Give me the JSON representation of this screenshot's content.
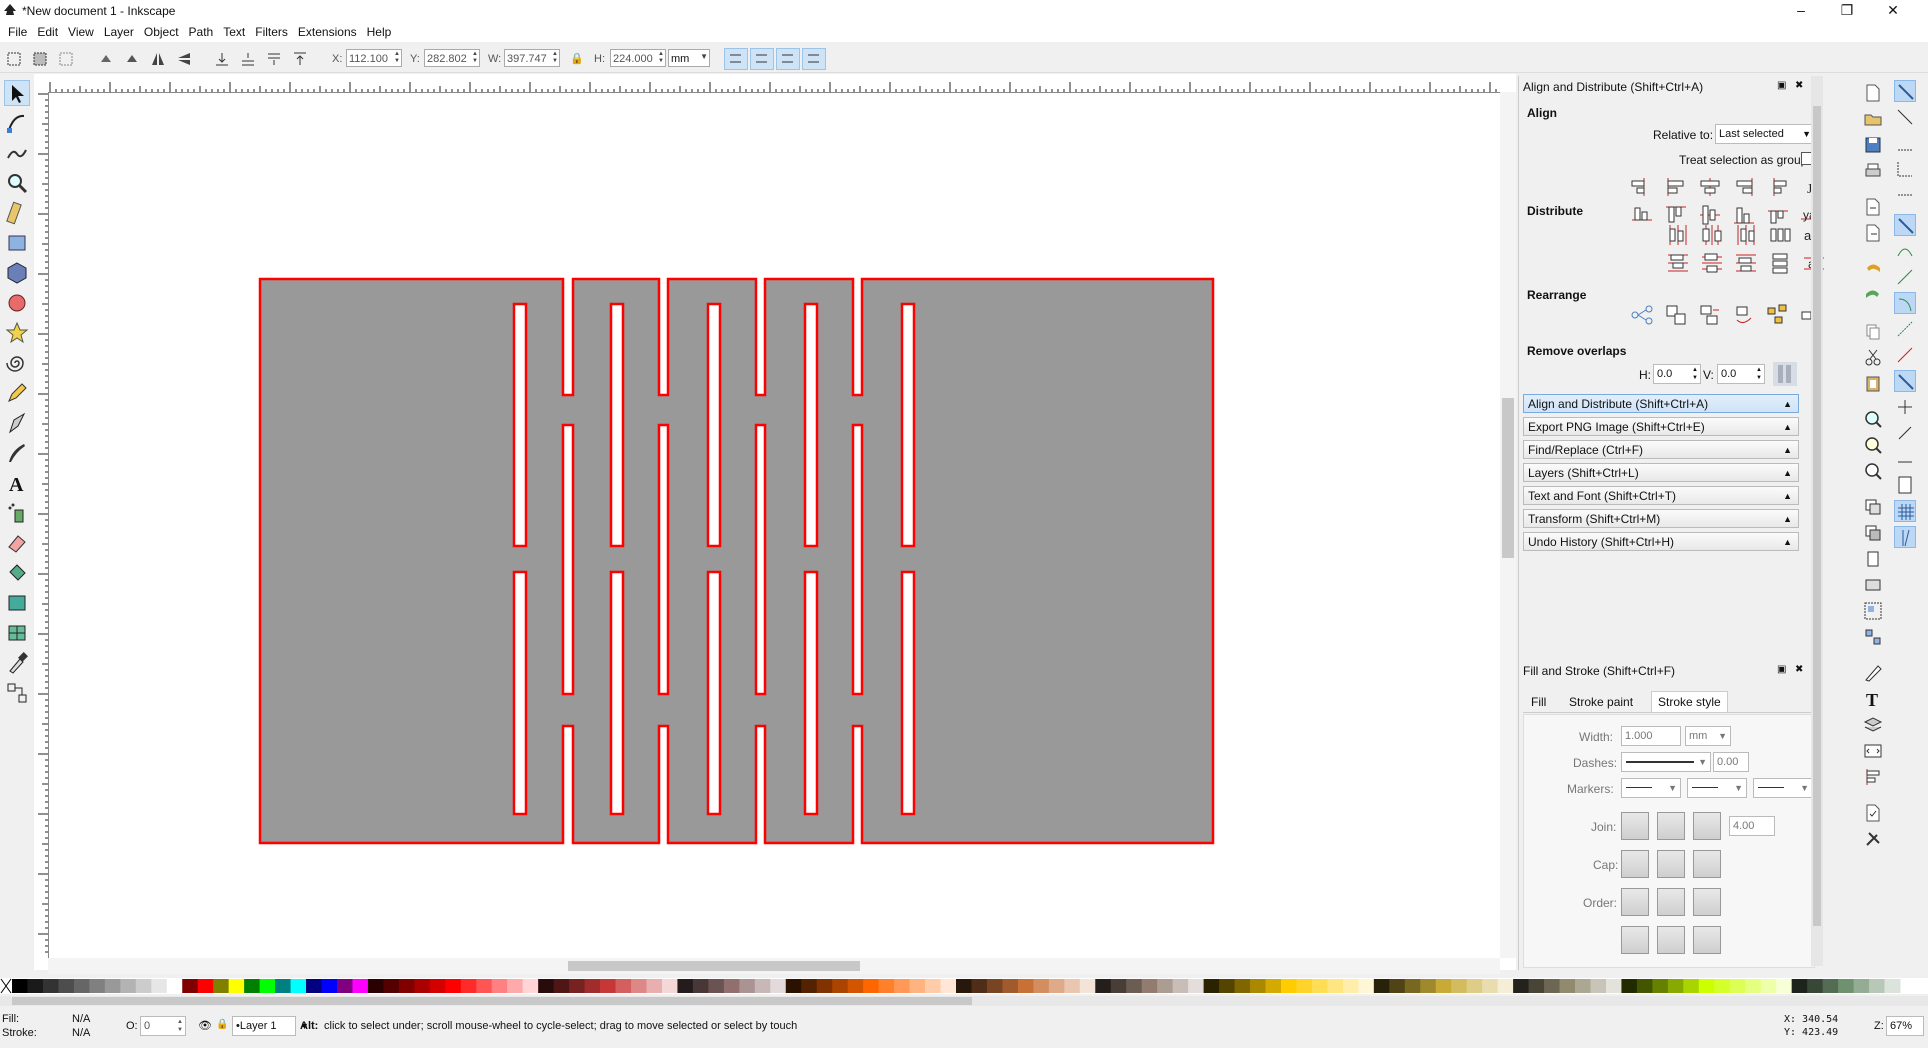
{
  "window": {
    "title": "*New document 1 - Inkscape",
    "minimize": "–",
    "maximize": "❐",
    "close": "✕"
  },
  "menu": [
    "File",
    "Edit",
    "View",
    "Layer",
    "Object",
    "Path",
    "Text",
    "Filters",
    "Extensions",
    "Help"
  ],
  "toolcontrols": {
    "x_label": "X:",
    "x_value": "112.100",
    "y_label": "Y:",
    "y_value": "282.802",
    "w_label": "W:",
    "w_value": "397.747",
    "h_label": "H:",
    "h_value": "224.000",
    "unit": "mm"
  },
  "tools": [
    "selector-tool",
    "node-tool",
    "tweak-tool",
    "zoom-tool",
    "measure-tool",
    "rectangle-tool",
    "3d-box-tool",
    "ellipse-tool",
    "star-tool",
    "spiral-tool",
    "pencil-tool",
    "pen-tool",
    "calligraphy-tool",
    "text-tool",
    "spray-tool",
    "eraser-tool",
    "paint-bucket-tool",
    "gradient-tool",
    "mesh-tool",
    "dropper-tool",
    "connector-tool"
  ],
  "align_panel": {
    "title": "Align and Distribute (Shift+Ctrl+A)",
    "align_heading": "Align",
    "relative_to_label": "Relative to:",
    "relative_to_value": "Last selected",
    "treat_group_label": "Treat selection as group:",
    "distribute_heading": "Distribute",
    "rearrange_heading": "Rearrange",
    "remove_overlaps_heading": "Remove overlaps",
    "h_label": "H:",
    "h_value": "0.0",
    "v_label": "V:",
    "v_value": "0.0"
  },
  "collapsed_panels": [
    "Align and Distribute (Shift+Ctrl+A)",
    "Export PNG Image (Shift+Ctrl+E)",
    "Find/Replace (Ctrl+F)",
    "Layers (Shift+Ctrl+L)",
    "Text and Font (Shift+Ctrl+T)",
    "Transform (Shift+Ctrl+M)",
    "Undo History (Shift+Ctrl+H)"
  ],
  "fill_stroke": {
    "title": "Fill and Stroke (Shift+Ctrl+F)",
    "tabs": [
      "Fill",
      "Stroke paint",
      "Stroke style"
    ],
    "width_label": "Width:",
    "width_value": "1.000",
    "width_unit": "mm",
    "dashes_label": "Dashes:",
    "dashes_value": "0.00",
    "markers_label": "Markers:",
    "join_label": "Join:",
    "miter_value": "4.00",
    "cap_label": "Cap:",
    "order_label": "Order:"
  },
  "status": {
    "fill_label": "Fill:",
    "fill_value": "N/A",
    "stroke_label": "Stroke:",
    "stroke_value": "N/A",
    "opacity_label": "O:",
    "opacity_value": "0",
    "layer": "•Layer 1",
    "message_bold": "Alt:",
    "message": "click to select under; scroll mouse-wheel to cycle-select; drag to move selected or select by touch",
    "x_coord": "X:  340.54",
    "y_coord": "Y:  423.49",
    "zoom_label": "Z:",
    "zoom_value": "67%"
  },
  "colors": {
    "shape_fill": "#999999",
    "shape_stroke": "#ff0000",
    "accent": "#cfe3f7"
  }
}
